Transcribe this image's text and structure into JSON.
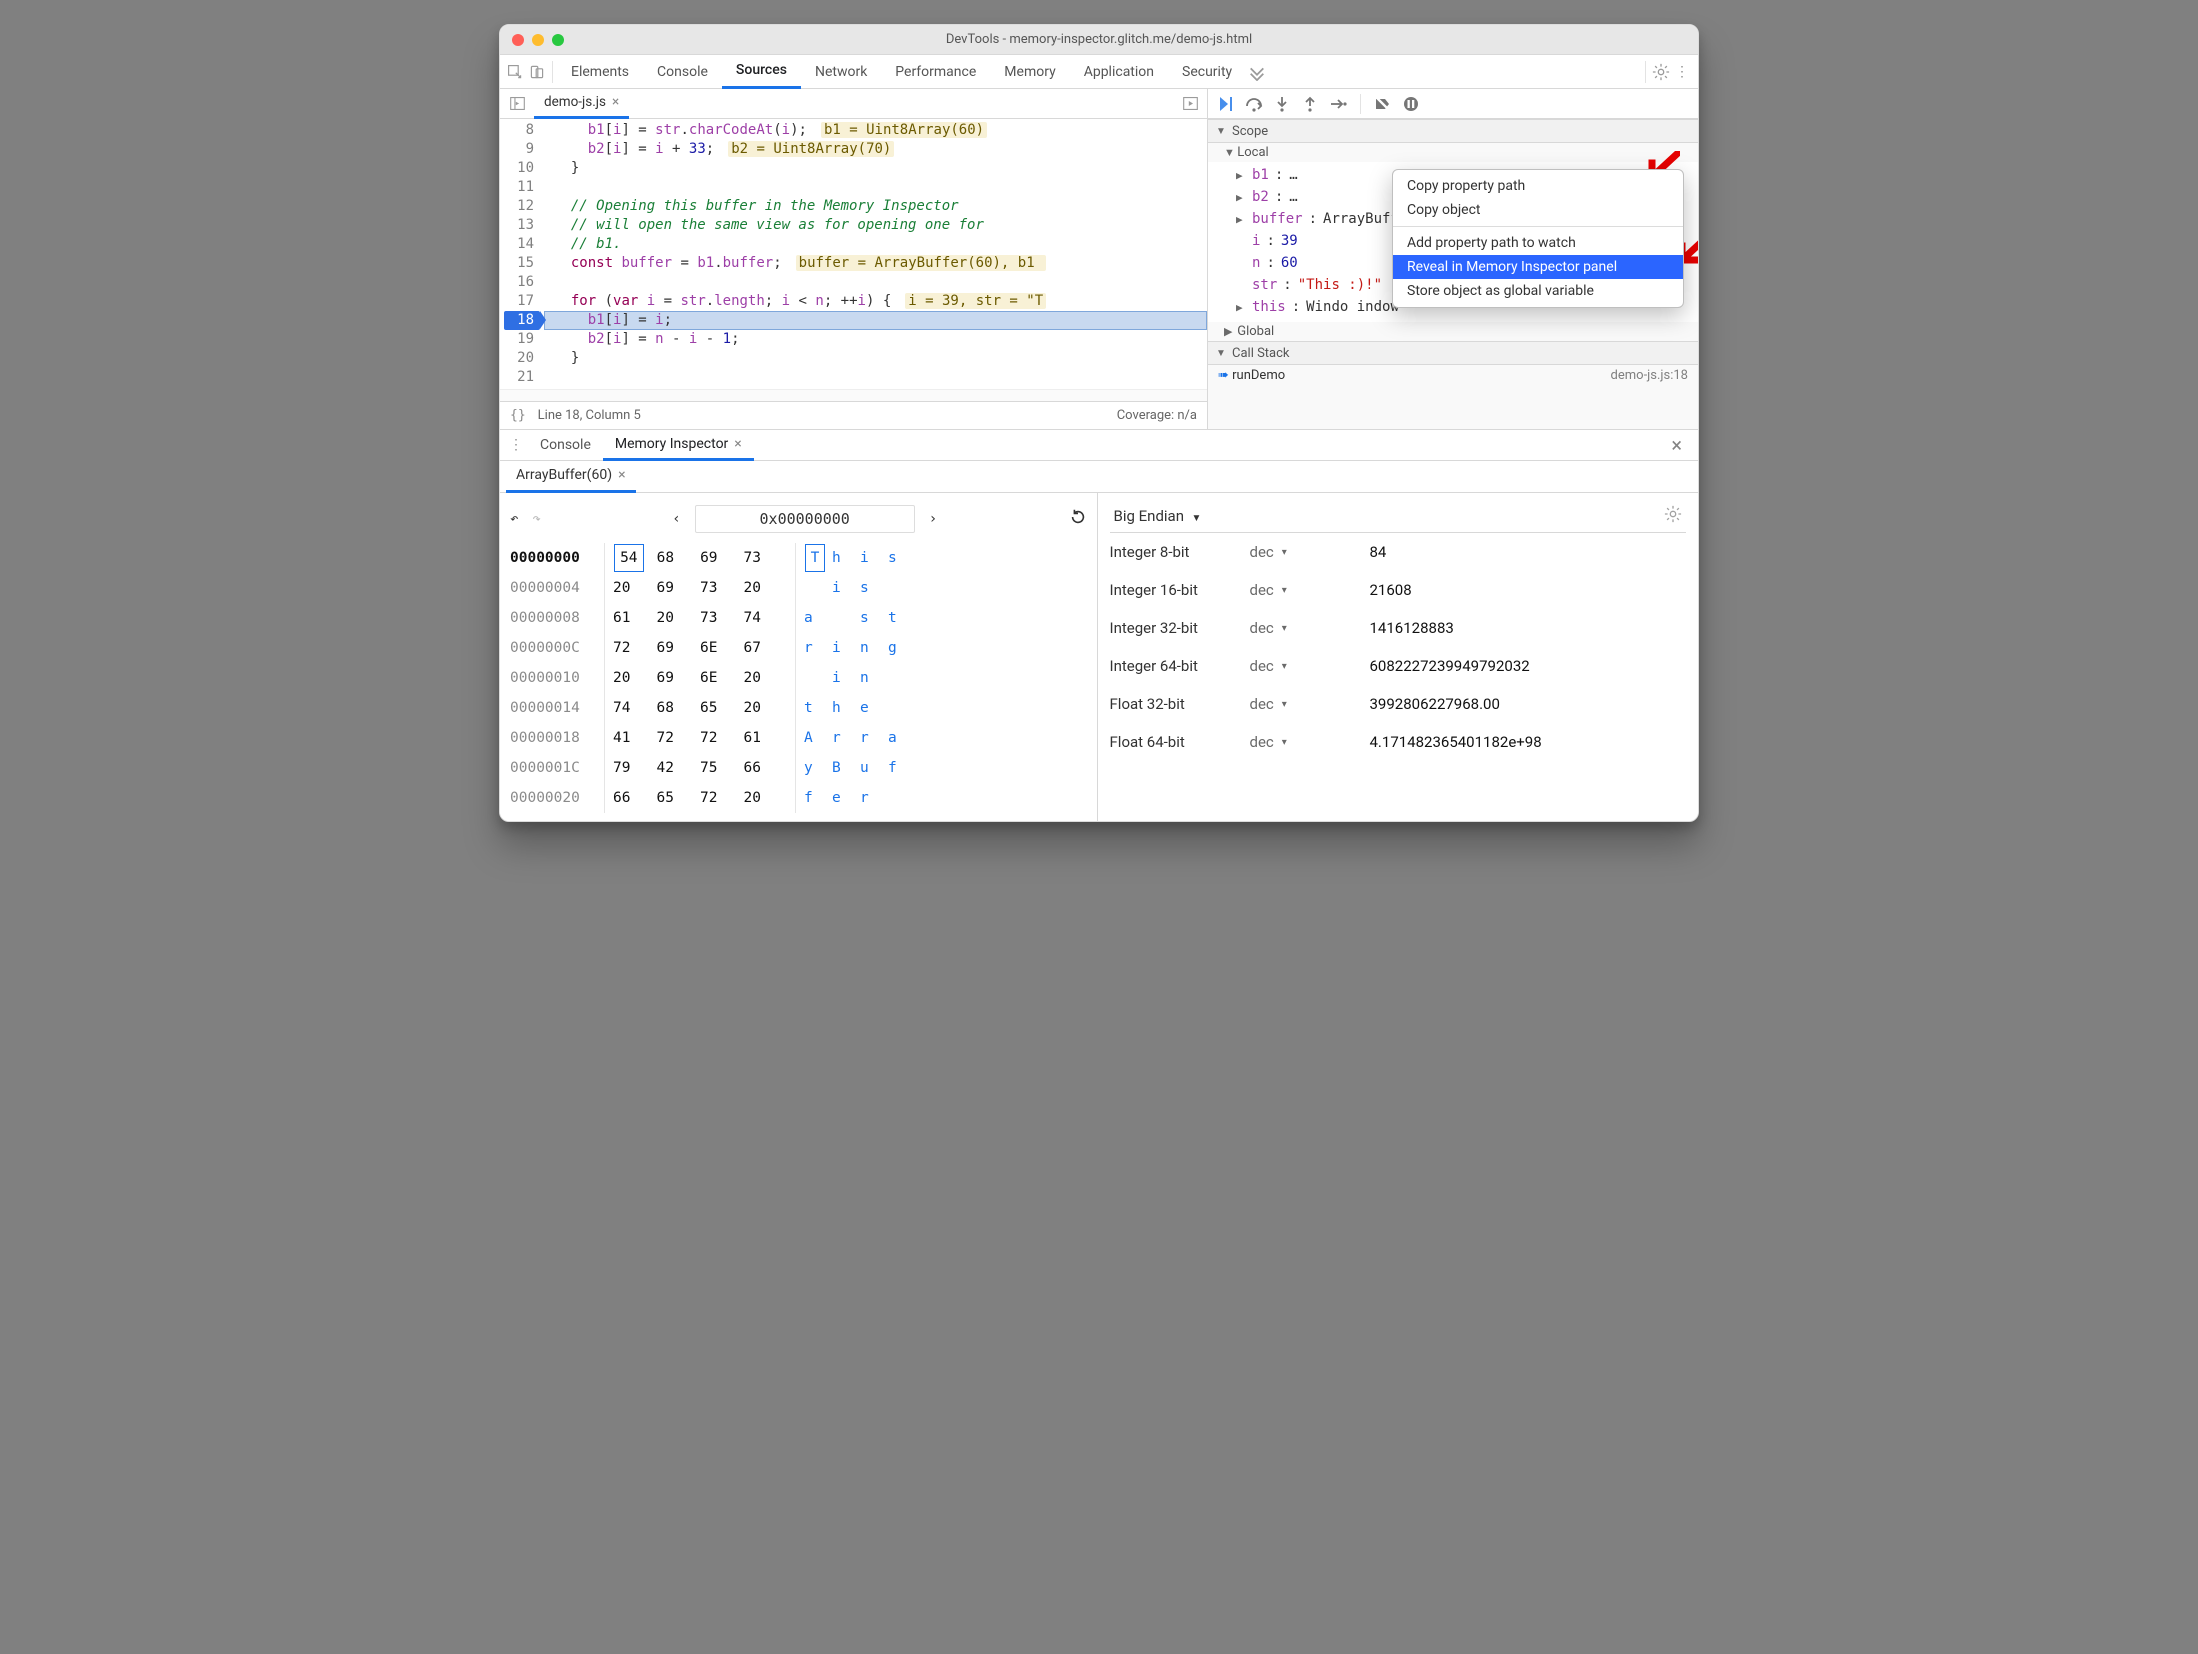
{
  "window": {
    "title": "DevTools - memory-inspector.glitch.me/demo-js.html"
  },
  "colors": {
    "close": "#ff5f57",
    "min": "#febc2e",
    "max": "#28c840"
  },
  "tabs": [
    "Elements",
    "Console",
    "Sources",
    "Network",
    "Performance",
    "Memory",
    "Application",
    "Security"
  ],
  "active_tab": "Sources",
  "file_tab": "demo-js.js",
  "editor_lines": [
    {
      "n": 8,
      "html": "    <span class='id'>b1</span>[<span class='id'>i</span>] = <span class='id'>str</span>.<span class='id'>charCodeAt</span>(<span class='id'>i</span>);",
      "inline": "b1 = Uint8Array(60)"
    },
    {
      "n": 9,
      "html": "    <span class='id'>b2</span>[<span class='id'>i</span>] = <span class='id'>i</span> + <span class='num'>33</span>;",
      "inline": "b2 = Uint8Array(70)"
    },
    {
      "n": 10,
      "html": "  }"
    },
    {
      "n": 11,
      "html": ""
    },
    {
      "n": 12,
      "html": "  <span class='cmt'>// Opening this buffer in the Memory Inspector</span>"
    },
    {
      "n": 13,
      "html": "  <span class='cmt'>// will open the same view as for opening one for</span>"
    },
    {
      "n": 14,
      "html": "  <span class='cmt'>// b1.</span>"
    },
    {
      "n": 15,
      "html": "  <span class='kw'>const</span> <span class='id'>buffer</span> = <span class='id'>b1</span>.<span class='id'>buffer</span>;",
      "inline": "buffer = ArrayBuffer(60), b1 "
    },
    {
      "n": 16,
      "html": ""
    },
    {
      "n": 17,
      "html": "  <span class='kw'>for</span> (<span class='kw'>var</span> <span class='id'>i</span> = <span class='id'>str</span>.<span class='id'>length</span>; <span class='id'>i</span> &lt; <span class='id'>n</span>; ++<span class='id'>i</span>) {",
      "inline": "i = 39, str = \"T"
    },
    {
      "n": 18,
      "html": "    <span class='id'>b1</span>[<span class='id'>i</span>] = <span class='id'>i</span>;",
      "exec": true
    },
    {
      "n": 19,
      "html": "    <span class='id'>b2</span>[<span class='id'>i</span>] = <span class='id'>n</span> - <span class='id'>i</span> - <span class='num'>1</span>;"
    },
    {
      "n": 20,
      "html": "  }"
    },
    {
      "n": 21,
      "html": ""
    }
  ],
  "status": {
    "left": "Line 18, Column 5",
    "right": "Coverage: n/a"
  },
  "scope": {
    "header": "Scope",
    "group": "Local",
    "rows": [
      {
        "tri": "▶",
        "key": "b1",
        "val": "…"
      },
      {
        "tri": "▶",
        "key": "b2",
        "val": "…"
      },
      {
        "tri": "▶",
        "key": "buffer",
        "val": "ArrayBuffer(60)",
        "chip": true
      },
      {
        "tri": "",
        "key": "i",
        "val": "39",
        "num": true
      },
      {
        "tri": "",
        "key": "n",
        "val": "60",
        "num": true
      },
      {
        "tri": "",
        "key": "str",
        "val": "\"This                                      :)!\"",
        "str": true
      },
      {
        "tri": "▶",
        "key": "this",
        "val": "Windo                                     indow"
      }
    ],
    "global": "Global",
    "callstack": "Call Stack",
    "frame": {
      "name": "runDemo",
      "file": "demo-js.js:18"
    }
  },
  "context_menu": [
    "Copy property path",
    "Copy object",
    "---",
    "Add property path to watch",
    "Reveal in Memory Inspector panel",
    "Store object as global variable"
  ],
  "context_menu_hl": 4,
  "drawer": {
    "tabs": [
      "Console",
      "Memory Inspector"
    ],
    "active": "Memory Inspector",
    "buffer_tab": "ArrayBuffer(60)",
    "addr": "0x00000000",
    "endian": "Big Endian",
    "hex": [
      {
        "addr": "00000000",
        "active": true,
        "bytes": [
          "54",
          "68",
          "69",
          "73"
        ],
        "ascii": [
          "T",
          "h",
          "i",
          "s"
        ],
        "hlByte": 0,
        "hlAscii": 0
      },
      {
        "addr": "00000004",
        "bytes": [
          "20",
          "69",
          "73",
          "20"
        ],
        "ascii": [
          " ",
          "i",
          "s",
          " "
        ]
      },
      {
        "addr": "00000008",
        "bytes": [
          "61",
          "20",
          "73",
          "74"
        ],
        "ascii": [
          "a",
          " ",
          "s",
          "t"
        ]
      },
      {
        "addr": "0000000C",
        "bytes": [
          "72",
          "69",
          "6E",
          "67"
        ],
        "ascii": [
          "r",
          "i",
          "n",
          "g"
        ]
      },
      {
        "addr": "00000010",
        "bytes": [
          "20",
          "69",
          "6E",
          "20"
        ],
        "ascii": [
          " ",
          "i",
          "n",
          " "
        ]
      },
      {
        "addr": "00000014",
        "bytes": [
          "74",
          "68",
          "65",
          "20"
        ],
        "ascii": [
          "t",
          "h",
          "e",
          " "
        ]
      },
      {
        "addr": "00000018",
        "bytes": [
          "41",
          "72",
          "72",
          "61"
        ],
        "ascii": [
          "A",
          "r",
          "r",
          "a"
        ]
      },
      {
        "addr": "0000001C",
        "bytes": [
          "79",
          "42",
          "75",
          "66"
        ],
        "ascii": [
          "y",
          "B",
          "u",
          "f"
        ]
      },
      {
        "addr": "00000020",
        "bytes": [
          "66",
          "65",
          "72",
          "20"
        ],
        "ascii": [
          "f",
          "e",
          "r",
          " "
        ]
      }
    ],
    "types": [
      {
        "t": "Integer 8-bit",
        "fmt": "dec",
        "v": "84"
      },
      {
        "t": "Integer 16-bit",
        "fmt": "dec",
        "v": "21608"
      },
      {
        "t": "Integer 32-bit",
        "fmt": "dec",
        "v": "1416128883"
      },
      {
        "t": "Integer 64-bit",
        "fmt": "dec",
        "v": "6082227239949792032"
      },
      {
        "t": "Float 32-bit",
        "fmt": "dec",
        "v": "3992806227968.00"
      },
      {
        "t": "Float 64-bit",
        "fmt": "dec",
        "v": "4.171482365401182e+98"
      }
    ]
  }
}
